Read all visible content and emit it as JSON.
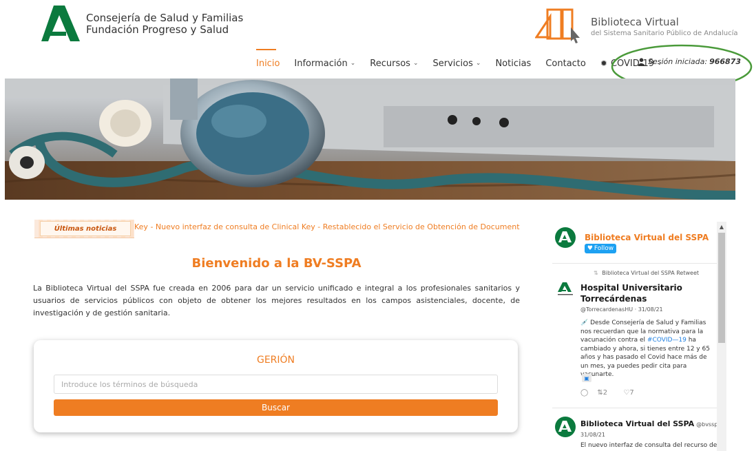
{
  "header": {
    "org_line1": "Consejería de Salud y Familias",
    "org_line2": "Fundación Progreso y Salud",
    "bv_title": "Biblioteca Virtual",
    "bv_subtitle": "del Sistema Sanitario Público de Andalucía",
    "brand_orange": "#ef7d22",
    "brand_green": "#0b7a3e"
  },
  "nav": {
    "items": [
      {
        "label": "Inicio",
        "active": true
      },
      {
        "label": "Información",
        "dropdown": true
      },
      {
        "label": "Recursos",
        "dropdown": true
      },
      {
        "label": "Servicios",
        "dropdown": true
      },
      {
        "label": "Noticias"
      },
      {
        "label": "Contacto"
      },
      {
        "label": "COVID-19",
        "dropdown": true,
        "icon": "gear-icon"
      }
    ],
    "session_label": "Sesión iniciada:",
    "session_id": "966873"
  },
  "news": {
    "label": "Últimas noticias",
    "ticker": "Key  -  Nuevo interfaz de consulta de Clinical Key  -  Restablecido el Servicio de Obtención de Documentos (SO"
  },
  "main": {
    "welcome_title": "Bienvenido a la BV-SSPA",
    "intro": "La Biblioteca Virtual del SSPA fue creada en 2006 para dar un servicio unificado e integral a los profesionales sanitarios y usuarios de servicios públicos con objeto de obtener los mejores resultados en los campos asistenciales, docente, de investigación y de gestión sanitaria."
  },
  "search": {
    "title": "GERIÓN",
    "placeholder": "Introduce los términos de búsqueda",
    "button_label": "Buscar"
  },
  "twitter": {
    "account_name": "Biblioteca Virtual del SSPA",
    "follow_label": "Follow",
    "retweet_note": "Biblioteca Virtual del SSPA Retweet",
    "tweet1": {
      "author_line1": "Hospital Universitario",
      "author_line2": "Torrecárdenas",
      "handle_date": "@TorrecardenasHU · 31/08/21",
      "text_pre": "💉 Desde Consejería de Salud y Familias nos recuerdan que la normativa para la vacunación contra el ",
      "hashtag": "#COVID—19",
      "text_post": " ha cambiado y ahora, si tienes entre 12 y 65 años y has pasado el Covid hace más de un mes, ya puedes pedir cita para vacunarte.",
      "retweets": "2",
      "likes": "7"
    },
    "tweet2": {
      "author": "Biblioteca Virtual del SSPA",
      "handle": "@bvsspa ·",
      "date": "31/08/21",
      "text": "El nuevo interfaz de consulta del recurso de"
    }
  }
}
